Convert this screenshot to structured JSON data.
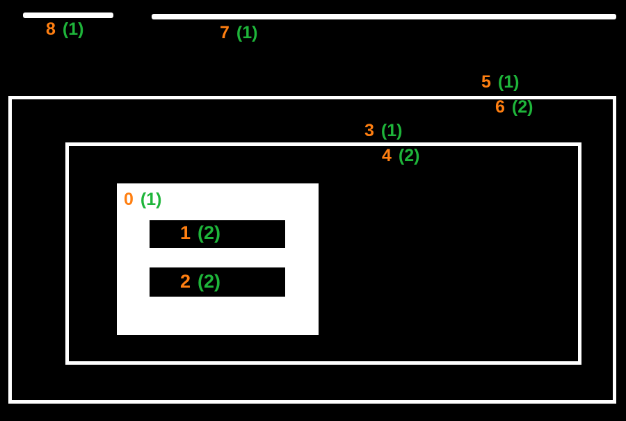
{
  "labels": {
    "l0": {
      "index": "0",
      "paren": "(1)"
    },
    "l1": {
      "index": "1",
      "paren": "(2)"
    },
    "l2": {
      "index": "2",
      "paren": "(2)"
    },
    "l3": {
      "index": "3",
      "paren": "(1)"
    },
    "l4": {
      "index": "4",
      "paren": "(2)"
    },
    "l5": {
      "index": "5",
      "paren": "(1)"
    },
    "l6": {
      "index": "6",
      "paren": "(2)"
    },
    "l7": {
      "index": "7",
      "paren": "(1)"
    },
    "l8": {
      "index": "8",
      "paren": "(1)"
    }
  }
}
